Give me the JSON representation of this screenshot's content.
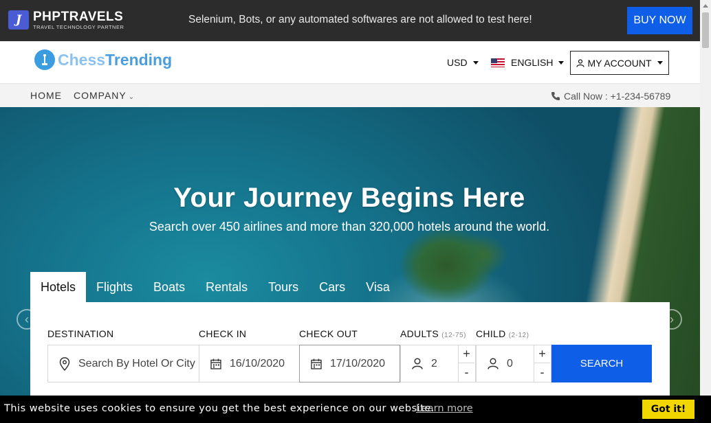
{
  "topbar": {
    "brand_name": "PHPTRAVELS",
    "brand_tagline": "TRAVEL TECHNOLOGY PARTNER",
    "promo_text": "Selenium, Bots, or any automated softwares are not allowed to test here!",
    "buy_label": "BUY NOW"
  },
  "header": {
    "logo_part1": "Chess",
    "logo_part2": "Trending",
    "currency": "USD",
    "language": "ENGLISH",
    "account_label": "MY ACCOUNT"
  },
  "nav": {
    "home": "HOME",
    "company": "COMPANY",
    "call": "Call Now : +1-234-56789"
  },
  "hero": {
    "title": "Your Journey Begins Here",
    "subtitle": "Search over 450 airlines and more than 320,000 hotels around the world."
  },
  "tabs": [
    {
      "label": "Hotels"
    },
    {
      "label": "Flights"
    },
    {
      "label": "Boats"
    },
    {
      "label": "Rentals"
    },
    {
      "label": "Tours"
    },
    {
      "label": "Cars"
    },
    {
      "label": "Visa"
    }
  ],
  "search": {
    "destination_label": "DESTINATION",
    "destination_placeholder": "Search By Hotel Or City",
    "checkin_label": "CHECK IN",
    "checkin_value": "16/10/2020",
    "checkout_label": "CHECK OUT",
    "checkout_value": "17/10/2020",
    "adults_label": "ADULTS",
    "adults_range": "(12-75)",
    "adults_value": "2",
    "child_label": "CHILD",
    "child_range": "(2-12)",
    "child_value": "0",
    "plus": "+",
    "minus": "-",
    "search_label": "SEARCH"
  },
  "cookie": {
    "message": "This website uses cookies to ensure you get the best experience on our website.",
    "learn_more": "Learn more",
    "accept_label": "Got it!"
  },
  "colors": {
    "accent": "#0f5ee8",
    "topbar_bg": "#2c2c2c",
    "cookie_button": "#f1d600"
  }
}
